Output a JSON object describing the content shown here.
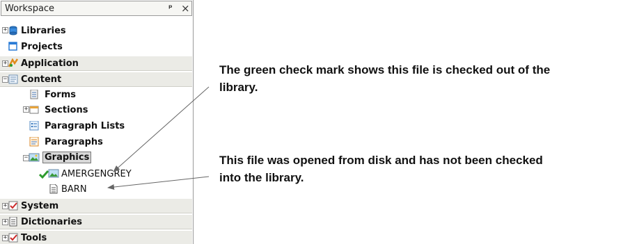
{
  "workspace": {
    "title": "Workspace",
    "pin_glyph": "ᵖ",
    "close_glyph": "×"
  },
  "tree": {
    "libraries": "Libraries",
    "projects": "Projects",
    "application": "Application",
    "content": "Content",
    "forms": "Forms",
    "sections": "Sections",
    "paragraph_lists": "Paragraph Lists",
    "paragraphs": "Paragraphs",
    "graphics": "Graphics",
    "amergengrey": "AMERGENGREY",
    "barn": "BARN",
    "system": "System",
    "dictionaries": "Dictionaries",
    "tools": "Tools"
  },
  "expanders": {
    "plus": "+",
    "minus": "−"
  },
  "annotations": {
    "checked_out_line1": "The green check mark shows this file is checked out of the",
    "checked_out_line2": "library.",
    "from_disk_line1": "This file was opened from disk and has not been checked",
    "from_disk_line2": "into the library."
  },
  "icons": {
    "libraries": "database-icon",
    "projects": "project-icon",
    "application": "application-icon",
    "content": "content-icon",
    "forms": "form-icon",
    "sections": "section-icon",
    "paragraph_lists": "paragraph-list-icon",
    "paragraphs": "paragraph-icon",
    "graphics": "graphics-icon",
    "checkmark": "green-check-icon",
    "document": "document-icon",
    "system": "system-icon",
    "dictionaries": "dictionary-icon",
    "tools": "tools-icon"
  },
  "colors": {
    "check_green": "#2e9b2e",
    "section_bg": "#ebebe6",
    "selection_bg": "#d9d9d9"
  }
}
